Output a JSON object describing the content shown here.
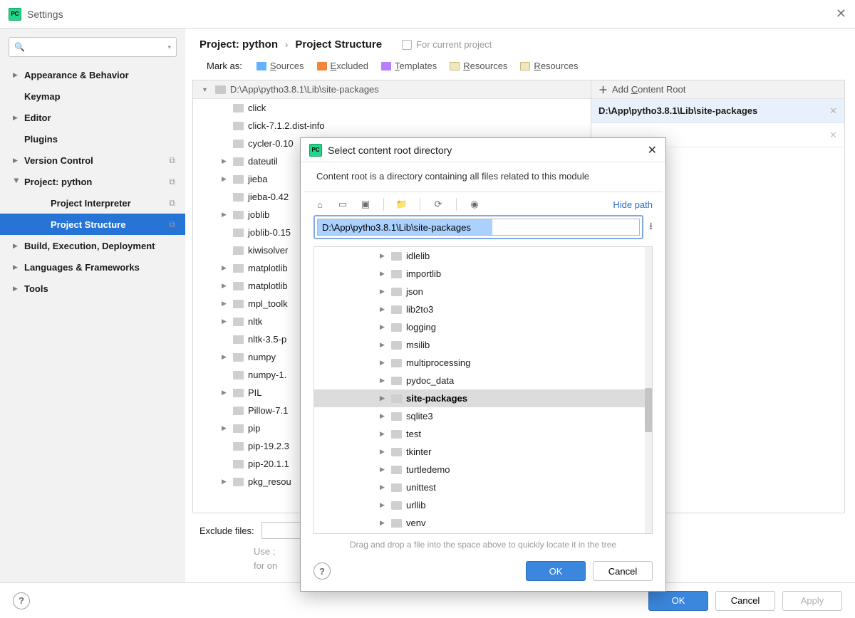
{
  "titlebar": {
    "title": "Settings"
  },
  "sidebar": {
    "items": [
      {
        "label": "Appearance & Behavior",
        "expandable": true
      },
      {
        "label": "Keymap"
      },
      {
        "label": "Editor",
        "expandable": true
      },
      {
        "label": "Plugins"
      },
      {
        "label": "Version Control",
        "expandable": true,
        "copy": true
      },
      {
        "label": "Project: python",
        "expandable": true,
        "open": true,
        "copy": true
      },
      {
        "label": "Project Interpreter",
        "indent": 1,
        "copy": true
      },
      {
        "label": "Project Structure",
        "indent": 1,
        "copy": true,
        "selected": true
      },
      {
        "label": "Build, Execution, Deployment",
        "expandable": true
      },
      {
        "label": "Languages & Frameworks",
        "expandable": true
      },
      {
        "label": "Tools",
        "expandable": true
      }
    ]
  },
  "breadcrumb": {
    "part1": "Project: python",
    "sep": "›",
    "part2": "Project Structure",
    "current_project": "For current project"
  },
  "markas": {
    "label": "Mark as:",
    "options": [
      {
        "cls": "sources",
        "text": "Sources",
        "u": "S"
      },
      {
        "cls": "excluded",
        "text": "Excluded",
        "u": "E"
      },
      {
        "cls": "templates",
        "text": "Templates",
        "u": "T"
      },
      {
        "cls": "res",
        "text": "Resources",
        "u": "R"
      },
      {
        "cls": "res2",
        "text": "Resources",
        "u": "R"
      }
    ]
  },
  "tree": {
    "root": "D:\\App\\pytho3.8.1\\Lib\\site-packages",
    "items": [
      {
        "name": "click"
      },
      {
        "name": "click-7.1.2.dist-info"
      },
      {
        "name": "cycler-0.10"
      },
      {
        "name": "dateutil",
        "has": true
      },
      {
        "name": "jieba",
        "has": true
      },
      {
        "name": "jieba-0.42"
      },
      {
        "name": "joblib",
        "has": true
      },
      {
        "name": "joblib-0.15"
      },
      {
        "name": "kiwisolver"
      },
      {
        "name": "matplotlib",
        "has": true
      },
      {
        "name": "matplotlib",
        "has": true
      },
      {
        "name": "mpl_toolk",
        "has": true
      },
      {
        "name": "nltk",
        "has": true
      },
      {
        "name": "nltk-3.5-p"
      },
      {
        "name": "numpy",
        "has": true
      },
      {
        "name": "numpy-1."
      },
      {
        "name": "PIL",
        "has": true
      },
      {
        "name": "Pillow-7.1"
      },
      {
        "name": "pip",
        "has": true
      },
      {
        "name": "pip-19.2.3"
      },
      {
        "name": "pip-20.1.1"
      },
      {
        "name": "pkg_resou",
        "has": true
      }
    ]
  },
  "right": {
    "add_label": "Add Content Root",
    "root": "D:\\App\\pytho3.8.1\\Lib\\site-packages"
  },
  "exclude": {
    "label": "Exclude files:",
    "hint1": "Use ;",
    "hint2": "for on"
  },
  "footer": {
    "ok": "OK",
    "cancel": "Cancel",
    "apply": "Apply"
  },
  "modal": {
    "title": "Select content root directory",
    "desc": "Content root is a directory containing all files related to this module",
    "hide_path": "Hide path",
    "path": "D:\\App\\pytho3.8.1\\Lib\\site-packages",
    "items": [
      {
        "name": "idlelib"
      },
      {
        "name": "importlib"
      },
      {
        "name": "json"
      },
      {
        "name": "lib2to3"
      },
      {
        "name": "logging"
      },
      {
        "name": "msilib"
      },
      {
        "name": "multiprocessing"
      },
      {
        "name": "pydoc_data"
      },
      {
        "name": "site-packages",
        "sel": true
      },
      {
        "name": "sqlite3"
      },
      {
        "name": "test"
      },
      {
        "name": "tkinter"
      },
      {
        "name": "turtledemo"
      },
      {
        "name": "unittest"
      },
      {
        "name": "urllib"
      },
      {
        "name": "venv"
      },
      {
        "name": " "
      }
    ],
    "hint": "Drag and drop a file into the space above to quickly locate it in the tree",
    "ok": "OK",
    "cancel": "Cancel"
  }
}
